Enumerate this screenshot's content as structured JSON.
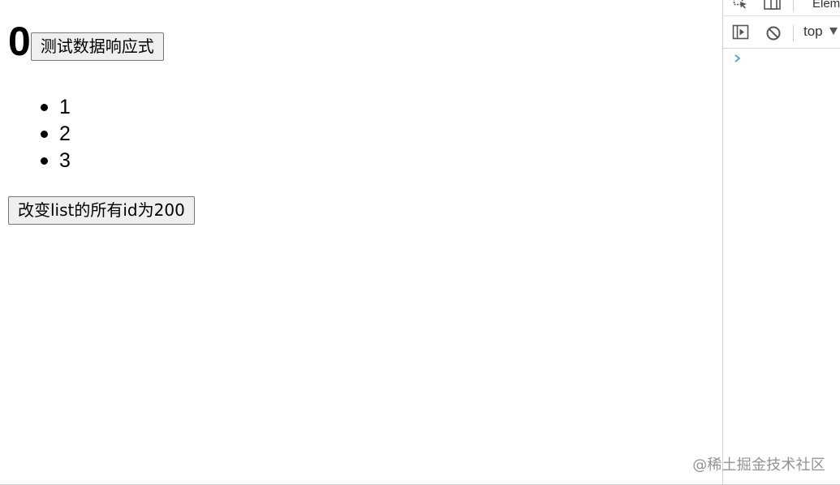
{
  "app": {
    "counter_value": "0",
    "test_reactive_button": "测试数据响应式",
    "list_items": [
      "1",
      "2",
      "3"
    ],
    "change_ids_button": "改变list的所有id为200"
  },
  "devtools": {
    "tab_label": "Elem",
    "context_selector": "top",
    "icons": {
      "inspect": "inspect-element-icon",
      "device": "device-toolbar-icon",
      "sidebar": "sidebar-toggle-icon",
      "clear": "clear-console-icon",
      "prompt": "console-prompt-icon",
      "dropdown": "chevron-down-icon"
    },
    "colors": {
      "prompt": "#5a9bd5",
      "icon": "#555555",
      "text": "#333333"
    }
  },
  "watermark": {
    "text": "@稀土掘金技术社区"
  }
}
